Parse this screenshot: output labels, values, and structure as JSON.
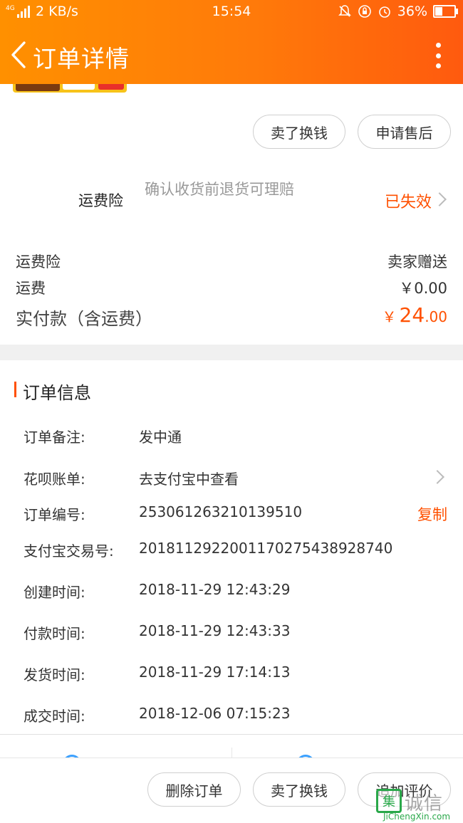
{
  "status_bar": {
    "network": "4G",
    "speed": "2 KB/s",
    "time": "15:54",
    "battery": "36%",
    "battery_level": 0.36,
    "icons": [
      "signal-icon",
      "bell-off-icon",
      "rotation-lock-icon",
      "alarm-icon",
      "battery-icon"
    ]
  },
  "header": {
    "title": "订单详情"
  },
  "top_actions": {
    "sell": "卖了换钱",
    "after_sales": "申请售后"
  },
  "insurance": {
    "label": "运费险",
    "description": "确认收货前退货可理赔",
    "status": "已失效"
  },
  "fees": [
    {
      "label": "运费险",
      "value": "卖家赠送"
    },
    {
      "label": "运费",
      "value": "￥0.00"
    }
  ],
  "total": {
    "label": "实付款（含运费）",
    "currency": "￥",
    "integer": "24",
    "decimal": ".00"
  },
  "order_info": {
    "title": "订单信息",
    "rows": [
      {
        "label": "订单备注:",
        "value": "发中通"
      },
      {
        "label": "花呗账单:",
        "value": "去支付宝中查看"
      },
      {
        "label": "订单编号:",
        "value": "253061263210139510",
        "action": "复制"
      },
      {
        "label": "支付宝交易号:",
        "value": "2018112922001170275438928740"
      },
      {
        "label": "创建时间:",
        "value": "2018-11-29 12:43:29"
      },
      {
        "label": "付款时间:",
        "value": "2018-11-29 12:43:33"
      },
      {
        "label": "发货时间:",
        "value": "2018-11-29 17:14:13"
      },
      {
        "label": "成交时间:",
        "value": "2018-12-06 07:15:23"
      }
    ]
  },
  "footer_actions": {
    "delete": "删除订单",
    "sell": "卖了换钱",
    "review": "追加评价"
  },
  "watermark": {
    "mark": "集",
    "text": "诚信",
    "url": "JiChengXin.com"
  },
  "colors": {
    "accent": "#ff5000",
    "header_start": "#ff9000",
    "header_end": "#ff5a0e"
  }
}
